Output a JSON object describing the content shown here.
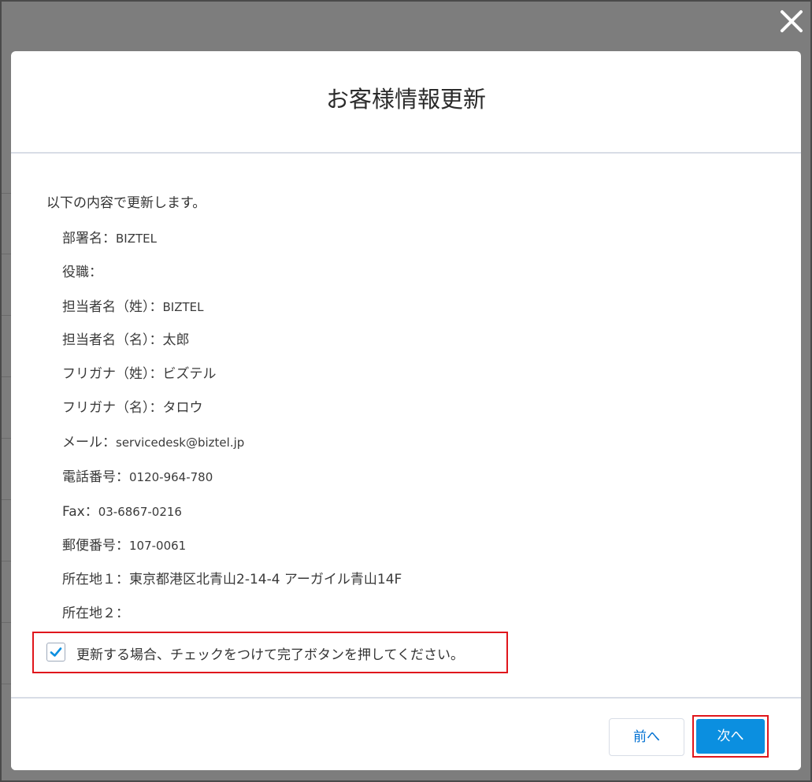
{
  "modal": {
    "title": "お客様情報更新",
    "intro": "以下の内容で更新します。",
    "fields": [
      {
        "label": "部署名：",
        "value": "BIZTEL"
      },
      {
        "label": "役職：",
        "value": ""
      },
      {
        "label": "担当者名（姓）：",
        "value": "BIZTEL"
      },
      {
        "label": "担当者名（名）：",
        "value": "太郎"
      },
      {
        "label": "フリガナ（姓）：",
        "value": "ビズテル"
      },
      {
        "label": "フリガナ（名）：",
        "value": "タロウ"
      },
      {
        "label": "メール：",
        "value": "servicedesk@biztel.jp"
      },
      {
        "label": "電話番号：",
        "value": "0120-964-780"
      },
      {
        "label": "Fax：",
        "value": "03-6867-0216"
      },
      {
        "label": "郵便番号：",
        "value": "107-0061"
      },
      {
        "label": "所在地１：",
        "value": "東京都港区北青山2-14-4 アーガイル青山14F"
      },
      {
        "label": "所在地２：",
        "value": ""
      }
    ],
    "confirm": {
      "checked": true,
      "label": "更新する場合、チェックをつけて完了ボタンを押してください。"
    },
    "footer": {
      "prev_label": "前へ",
      "next_label": "次へ"
    }
  },
  "icons": {
    "close": "close-icon",
    "check": "check-icon"
  },
  "colors": {
    "accent": "#0b8fe0",
    "highlight": "#e0161c",
    "link": "#0070d2"
  }
}
